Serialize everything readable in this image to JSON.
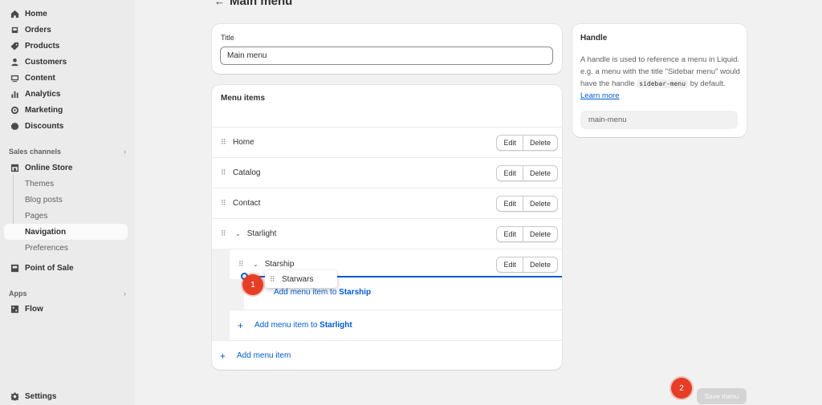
{
  "sidebar": {
    "items": [
      {
        "label": "Home",
        "icon": "home-icon"
      },
      {
        "label": "Orders",
        "icon": "orders-icon"
      },
      {
        "label": "Products",
        "icon": "tag-icon"
      },
      {
        "label": "Customers",
        "icon": "person-icon"
      },
      {
        "label": "Content",
        "icon": "content-icon"
      },
      {
        "label": "Analytics",
        "icon": "bar-chart-icon"
      },
      {
        "label": "Marketing",
        "icon": "target-icon"
      },
      {
        "label": "Discounts",
        "icon": "discount-icon"
      }
    ],
    "sales_channels_label": "Sales channels",
    "online_store": "Online Store",
    "online_store_sub": [
      "Themes",
      "Blog posts",
      "Pages",
      "Navigation",
      "Preferences"
    ],
    "point_of_sale": "Point of Sale",
    "apps_label": "Apps",
    "flow": "Flow",
    "settings": "Settings"
  },
  "header": {
    "back": "←",
    "title": "Main menu"
  },
  "title_card": {
    "label": "Title",
    "value": "Main menu"
  },
  "menu_card": {
    "heading": "Menu items",
    "rows": [
      {
        "label": "Home"
      },
      {
        "label": "Catalog"
      },
      {
        "label": "Contact"
      },
      {
        "label": "Starlight"
      },
      {
        "label": "Starship"
      }
    ],
    "edit_label": "Edit",
    "delete_label": "Delete",
    "dragging_item": "Starwars",
    "add_starship_prefix": "Add menu item to",
    "add_starship_target": "Starship",
    "add_starlight_prefix": "Add menu item to",
    "add_starlight_target": "Starlight",
    "add_menu_item": "Add menu item",
    "plus": "+"
  },
  "handle_card": {
    "heading": "Handle",
    "text_1": "A handle is used to reference a menu in Liquid. e.g. a menu with the title \"Sidebar menu\" would have the handle",
    "code": "sidebar-menu",
    "text_2": "by default.",
    "link": "Learn more",
    "value": "main-menu"
  },
  "badges": {
    "step1": "1",
    "step2": "2"
  },
  "save_button": "Save menu",
  "chevron_right": "›",
  "chevron_down": "⌄",
  "drag_handle": "⠿",
  "colors": {
    "accent": "#005bd3",
    "badge": "#e53d26",
    "sidebar_bg": "#ebebeb",
    "page_bg": "#f1f1f1"
  }
}
